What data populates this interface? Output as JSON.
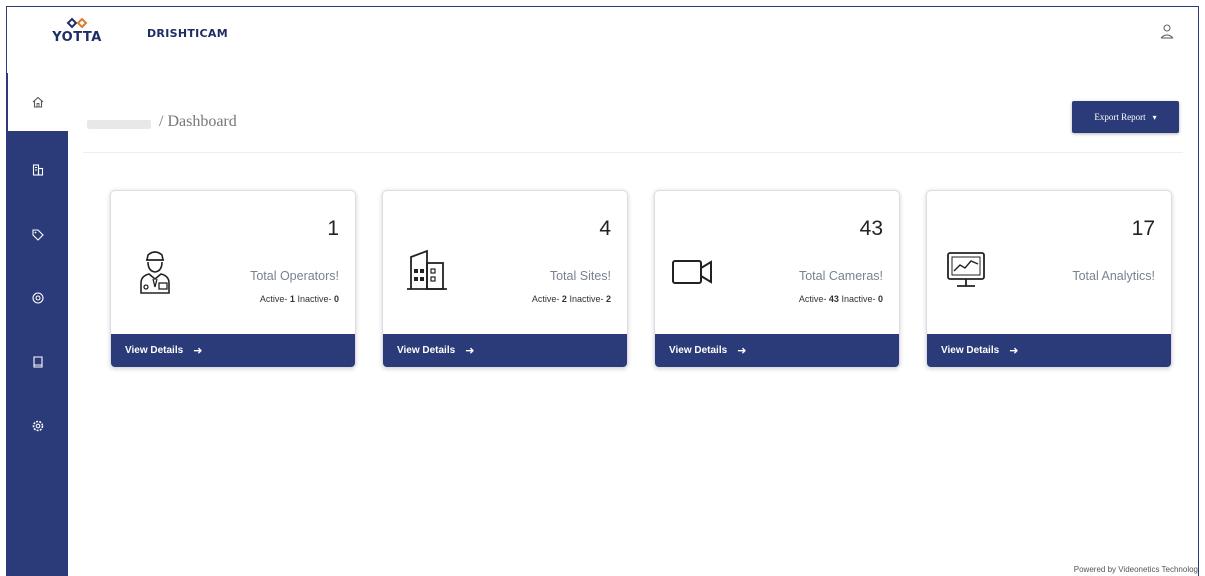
{
  "header": {
    "logo_text": "YOTTA",
    "app_name": "DRISHTICAM"
  },
  "sidebar": {
    "items": [
      {
        "icon": "home-icon"
      },
      {
        "icon": "building-icon"
      },
      {
        "icon": "tag-icon"
      },
      {
        "icon": "at-icon"
      },
      {
        "icon": "bookmark-icon"
      },
      {
        "icon": "settings-icon"
      }
    ],
    "active_index": 0
  },
  "breadcrumb": {
    "current": "/ Dashboard"
  },
  "export": {
    "label": "Export Report"
  },
  "cards": [
    {
      "count": "1",
      "label": "Total Operators!",
      "active_label": "Active-",
      "active_value": "1",
      "inactive_label": "Inactive-",
      "inactive_value": "0",
      "footer": "View Details",
      "icon": "operator-icon"
    },
    {
      "count": "4",
      "label": "Total Sites!",
      "active_label": "Active-",
      "active_value": "2",
      "inactive_label": "Inactive-",
      "inactive_value": "2",
      "footer": "View Details",
      "icon": "building-icon"
    },
    {
      "count": "43",
      "label": "Total Cameras!",
      "active_label": "Active-",
      "active_value": "43",
      "inactive_label": "Inactive-",
      "inactive_value": "0",
      "footer": "View Details",
      "icon": "video-camera-icon"
    },
    {
      "count": "17",
      "label": "Total Analytics!",
      "footer": "View Details",
      "icon": "analytics-monitor-icon"
    }
  ],
  "footer": {
    "powered_by": "Powered by Videonetics Technolog"
  },
  "colors": {
    "primary": "#2b3a78",
    "muted_label": "#7a8193"
  }
}
